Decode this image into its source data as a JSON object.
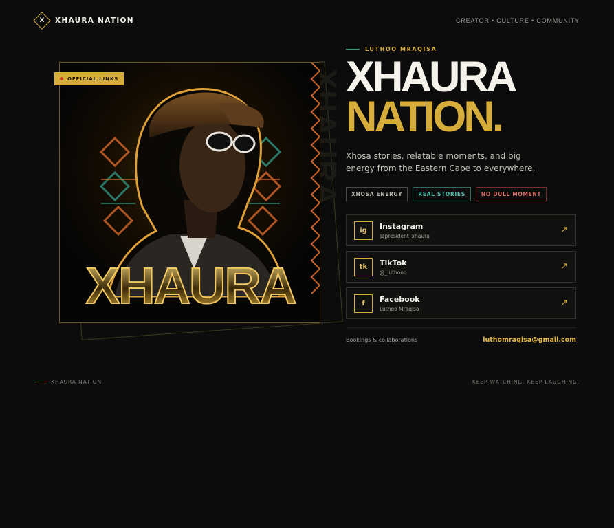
{
  "header": {
    "brand_letter": "X",
    "brand_name": "XHAURA NATION",
    "tagline": "CREATOR • CULTURE • COMMUNITY"
  },
  "poster": {
    "badge": "OFFICIAL LINKS",
    "title_word": "XHAURA",
    "ghost_word": "XHAURA"
  },
  "hero": {
    "eyebrow": "LUTHOO MRAQISA",
    "headline_line1": "XHAURA",
    "headline_line2": "NATION.",
    "description": "Xhosa stories, relatable moments, and big energy from the Eastern Cape to everywhere."
  },
  "tags": [
    "XHOSA ENERGY",
    "REAL STORIES",
    "NO DULL MOMENT"
  ],
  "socials": [
    {
      "icon": "ig",
      "name": "Instagram",
      "handle": "@president_xhaura",
      "icon_name": "instagram-icon"
    },
    {
      "icon": "tk",
      "name": "TikTok",
      "handle": "@_luthooo",
      "icon_name": "tiktok-icon"
    },
    {
      "icon": "f",
      "name": "Facebook",
      "handle": "Luthoo Mraqisa",
      "icon_name": "facebook-icon"
    }
  ],
  "arrow_glyph": "↗",
  "bookings": {
    "label": "Bookings & collaborations",
    "email": "luthomraqisa@gmail.com"
  },
  "footer": {
    "left": "XHAURA NATION",
    "right": "KEEP WATCHING. KEEP LAUGHING."
  },
  "colors": {
    "background": "#0c0c0c",
    "gold": "#d6ad3b",
    "teal": "#4fc2ac",
    "red": "#e0706a"
  }
}
